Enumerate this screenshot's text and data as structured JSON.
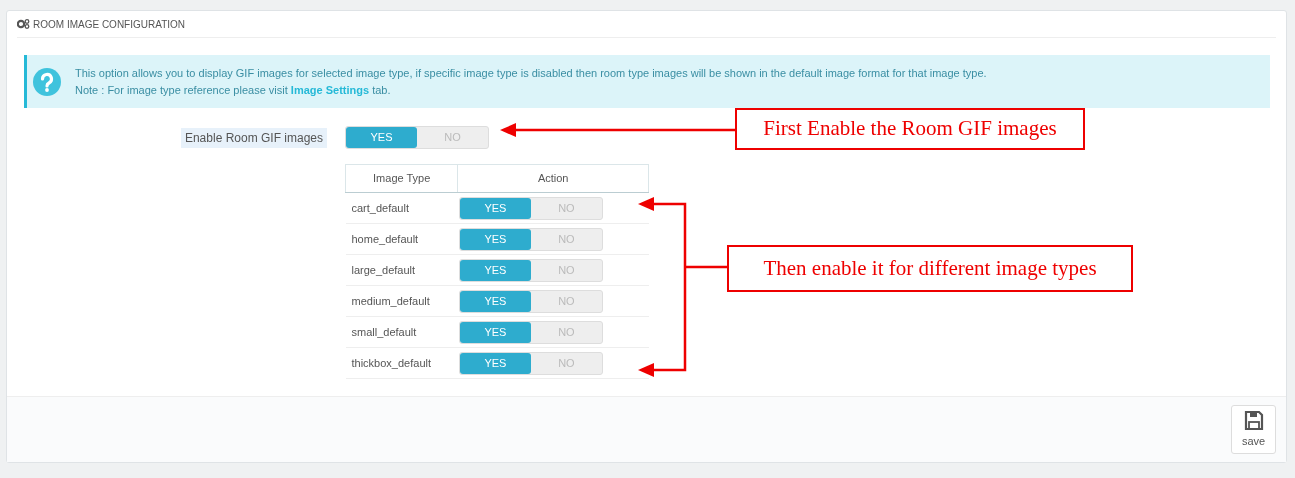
{
  "panel": {
    "title": "ROOM IMAGE CONFIGURATION"
  },
  "alert": {
    "text": "This option allows you to display GIF images for selected image type, if specific image type is disabled then room type images will be shown in the default image format for that image type.",
    "note_prefix": "Note : For image type reference please visit",
    "link": "Image Settings",
    "note_suffix": "tab."
  },
  "enable_field": {
    "label": "Enable Room GIF images",
    "yes": "YES",
    "no": "NO",
    "on": true
  },
  "table": {
    "columns": [
      "Image Type",
      "Action"
    ],
    "rows": [
      {
        "name": "cart_default",
        "yes": "YES",
        "no": "NO",
        "on": true
      },
      {
        "name": "home_default",
        "yes": "YES",
        "no": "NO",
        "on": true
      },
      {
        "name": "large_default",
        "yes": "YES",
        "no": "NO",
        "on": true
      },
      {
        "name": "medium_default",
        "yes": "YES",
        "no": "NO",
        "on": true
      },
      {
        "name": "small_default",
        "yes": "YES",
        "no": "NO",
        "on": true
      },
      {
        "name": "thickbox_default",
        "yes": "YES",
        "no": "NO",
        "on": true
      }
    ]
  },
  "annotations": [
    "First Enable the Room GIF images",
    "Then enable it for different image types"
  ],
  "save_button": {
    "label": "save"
  }
}
